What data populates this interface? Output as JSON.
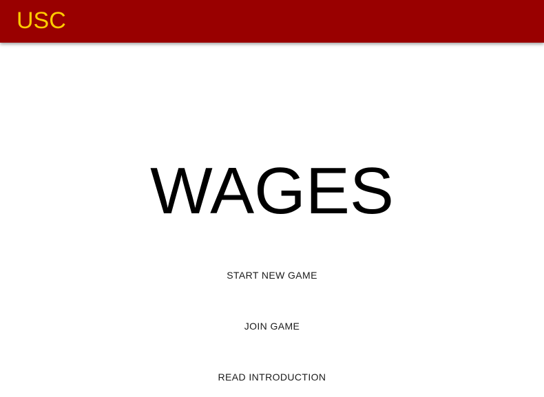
{
  "header": {
    "brand": "USC",
    "background_color": "#990000",
    "brand_color": "#ffcc00"
  },
  "main": {
    "title": "WAGES",
    "buttons": {
      "start_new_game": "START NEW GAME",
      "join_game": "JOIN GAME",
      "read_introduction": "READ INTRODUCTION"
    }
  }
}
